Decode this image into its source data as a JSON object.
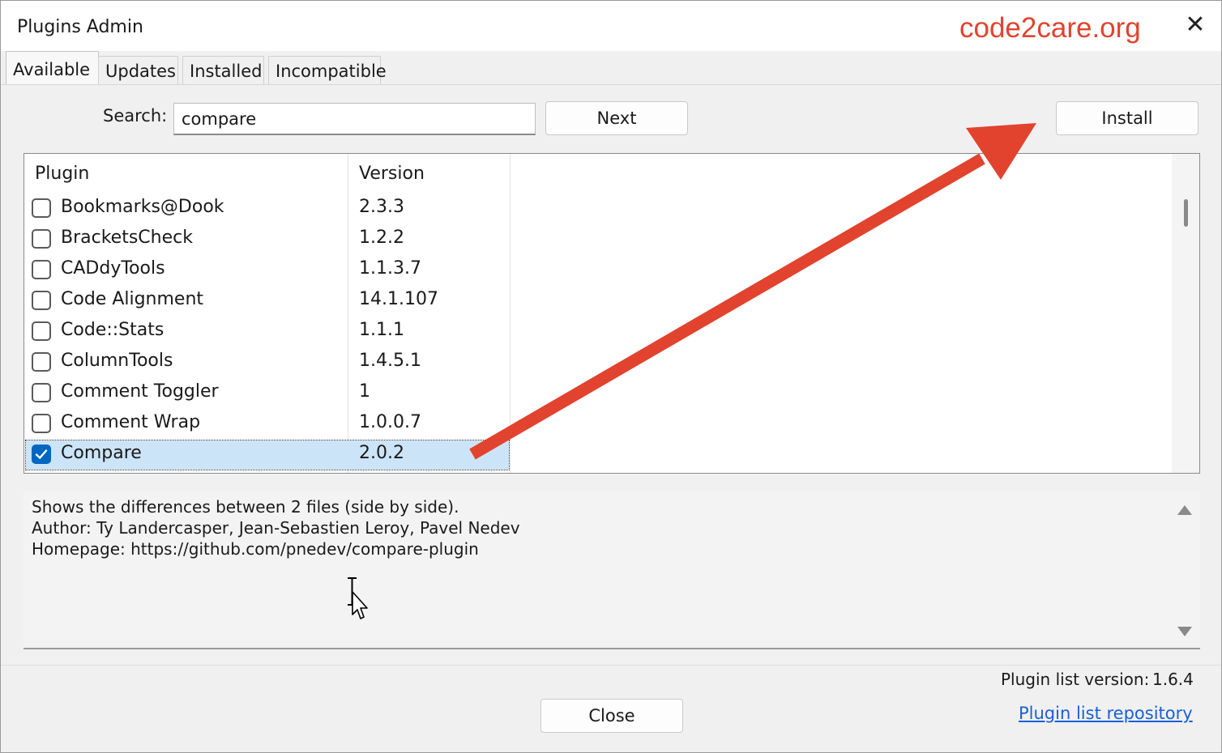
{
  "window": {
    "title": "Plugins Admin",
    "watermark": "code2care.org",
    "close_glyph": "✕"
  },
  "tabs": [
    {
      "label": "Available",
      "active": true
    },
    {
      "label": "Updates",
      "active": false
    },
    {
      "label": "Installed",
      "active": false
    },
    {
      "label": "Incompatible",
      "active": false
    }
  ],
  "search": {
    "label": "Search:",
    "value": "compare",
    "next_label": "Next",
    "install_label": "Install"
  },
  "table": {
    "columns": {
      "plugin": "Plugin",
      "version": "Version"
    },
    "rows": [
      {
        "name": "Bookmarks@Dook",
        "version": "2.3.3",
        "checked": false
      },
      {
        "name": "BracketsCheck",
        "version": "1.2.2",
        "checked": false
      },
      {
        "name": "CADdyTools",
        "version": "1.1.3.7",
        "checked": false
      },
      {
        "name": "Code Alignment",
        "version": "14.1.107",
        "checked": false
      },
      {
        "name": "Code::Stats",
        "version": "1.1.1",
        "checked": false
      },
      {
        "name": "ColumnTools",
        "version": "1.4.5.1",
        "checked": false
      },
      {
        "name": "Comment Toggler",
        "version": "1",
        "checked": false
      },
      {
        "name": "Comment Wrap",
        "version": "1.0.0.7",
        "checked": false
      },
      {
        "name": "Compare",
        "version": "2.0.2",
        "checked": true,
        "selected": true
      }
    ]
  },
  "description": {
    "line1": "Shows the differences between 2 files (side by side).",
    "line2": "Author: Ty Landercasper, Jean-Sebastien Leroy, Pavel Nedev",
    "line3": "Homepage: https://github.com/pnedev/compare-plugin"
  },
  "footer": {
    "plugin_list_version_label": "Plugin list version:",
    "plugin_list_version_value": "1.6.4",
    "close_label": "Close",
    "repository_link": "Plugin list repository"
  },
  "colors": {
    "annotation_arrow": "#e1432f",
    "selection": "#cce4f7",
    "checkbox_checked": "#0067c0",
    "link": "#1a5fd6"
  },
  "icons": {
    "checkmark": "checkmark-icon",
    "close": "close-icon",
    "annotation": "red-arrow-annotation",
    "cursor": "mouse-cursor-icon"
  }
}
